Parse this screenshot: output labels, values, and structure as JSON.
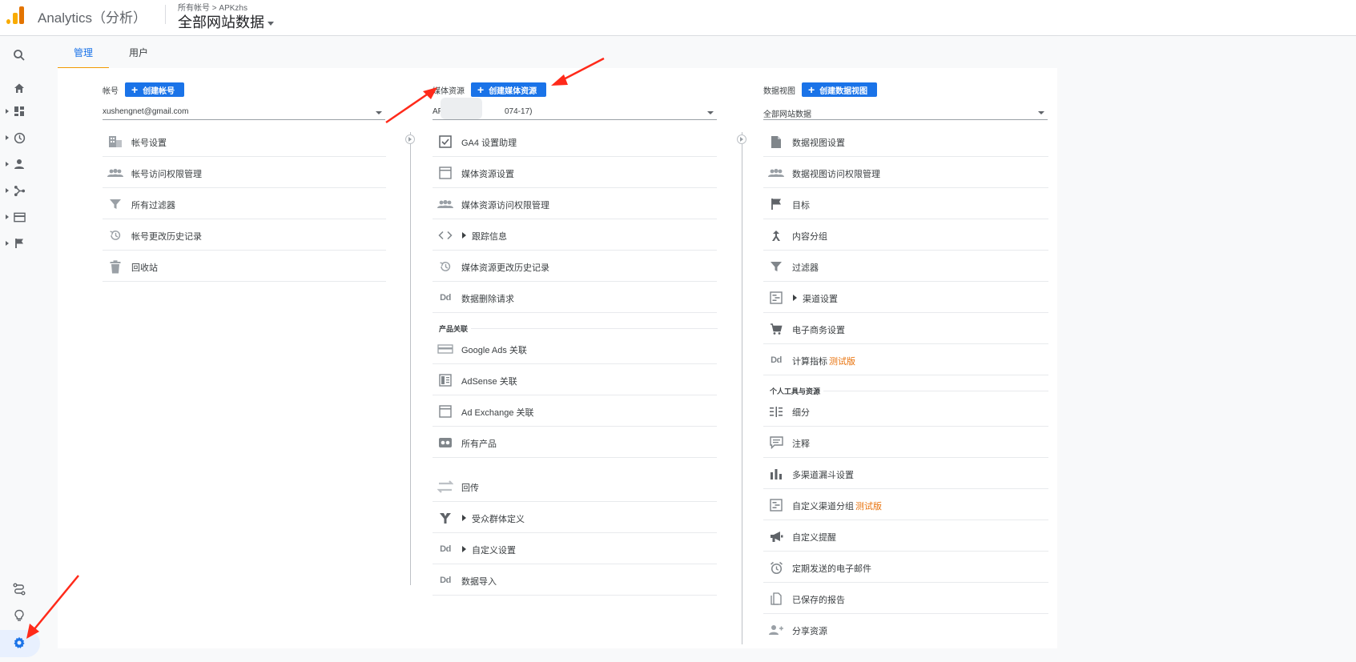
{
  "header": {
    "app_name": "Analytics（分析）",
    "breadcrumb_root": "所有帐号",
    "breadcrumb_sep": ">",
    "breadcrumb_account": "APKzhs",
    "view_title": "全部网站数据"
  },
  "nav": {
    "icons": [
      "search-icon",
      "home-icon",
      "dashboard-icon",
      "clock-icon",
      "person-icon",
      "acquisition-icon",
      "behavior-icon",
      "flag-icon",
      "route-icon",
      "lightbulb-icon",
      "gear-icon"
    ]
  },
  "tabs": [
    {
      "label": "管理",
      "active": true
    },
    {
      "label": "用户",
      "active": false
    }
  ],
  "account": {
    "label": "帐号",
    "create_label": "创建帐号",
    "selected": "xushengnet@gmail.com",
    "items": [
      {
        "label": "帐号设置"
      },
      {
        "label": "帐号访问权限管理"
      },
      {
        "label": "所有过滤器"
      },
      {
        "label": "帐号更改历史记录"
      },
      {
        "label": "回收站"
      }
    ]
  },
  "property": {
    "label": "媒体资源",
    "create_label": "创建媒体资源",
    "selected_prefix": "AF",
    "selected_suffix": "074-17)",
    "items": [
      {
        "label": "GA4 设置助理"
      },
      {
        "label": "媒体资源设置"
      },
      {
        "label": "媒体资源访问权限管理"
      },
      {
        "label": "跟踪信息"
      },
      {
        "label": "媒体资源更改历史记录"
      },
      {
        "label": "数据删除请求"
      }
    ],
    "section_product": "产品关联",
    "product_items": [
      {
        "label": "Google Ads 关联"
      },
      {
        "label": "AdSense 关联"
      },
      {
        "label": "Ad Exchange 关联"
      },
      {
        "label": "所有产品"
      }
    ],
    "more_items": [
      {
        "label": "回传"
      },
      {
        "label": "受众群体定义"
      },
      {
        "label": "自定义设置"
      },
      {
        "label": "数据导入"
      }
    ]
  },
  "view": {
    "label": "数据视图",
    "create_label": "创建数据视图",
    "selected": "全部网站数据",
    "items": [
      {
        "label": "数据视图设置"
      },
      {
        "label": "数据视图访问权限管理"
      },
      {
        "label": "目标"
      },
      {
        "label": "内容分组"
      },
      {
        "label": "过滤器"
      },
      {
        "label": "渠道设置"
      },
      {
        "label": "电子商务设置"
      },
      {
        "label": "计算指标",
        "badge": "测试版"
      }
    ],
    "section_personal": "个人工具与资源",
    "personal_items": [
      {
        "label": "细分"
      },
      {
        "label": "注释"
      },
      {
        "label": "多渠道漏斗设置"
      },
      {
        "label": "自定义渠道分组",
        "badge": "测试版"
      },
      {
        "label": "自定义提醒"
      },
      {
        "label": "定期发送的电子邮件"
      },
      {
        "label": "已保存的报告"
      },
      {
        "label": "分享资源"
      }
    ]
  },
  "colors": {
    "accent": "#1a73e8",
    "tab_underline": "#f29900",
    "logo": "#f9ab00",
    "arrow": "#ff2a1a",
    "beta": "#e8710a"
  }
}
